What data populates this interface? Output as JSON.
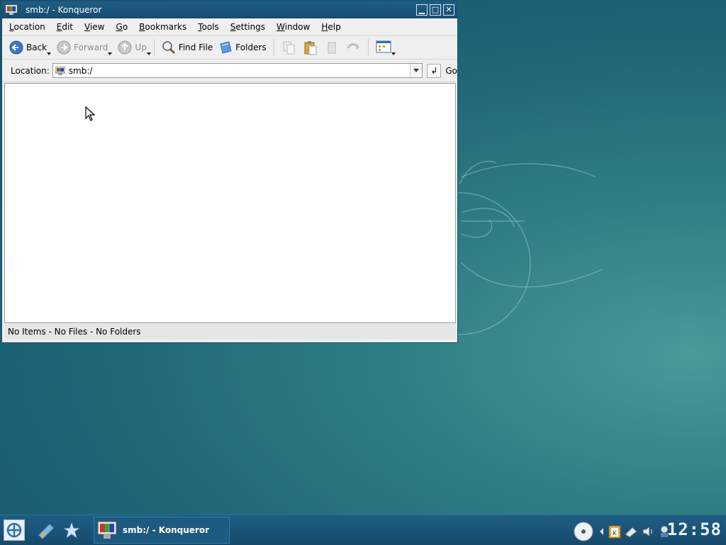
{
  "window": {
    "title": "smb:/ - Konqueror",
    "controls": {
      "minimize": "▁",
      "maximize": "□",
      "close": "✕"
    }
  },
  "menubar": {
    "items": [
      {
        "label": "Location",
        "underline": "L",
        "rest": "ocation"
      },
      {
        "label": "Edit",
        "underline": "E",
        "rest": "dit"
      },
      {
        "label": "View",
        "underline": "V",
        "rest": "iew"
      },
      {
        "label": "Go",
        "underline": "G",
        "rest": "o"
      },
      {
        "label": "Bookmarks",
        "underline": "B",
        "rest": "ookmarks"
      },
      {
        "label": "Tools",
        "underline": "T",
        "rest": "ools"
      },
      {
        "label": "Settings",
        "underline": "S",
        "rest": "ettings"
      },
      {
        "label": "Window",
        "underline": "W",
        "rest": "indow"
      },
      {
        "label": "Help",
        "underline": "H",
        "rest": "elp"
      }
    ]
  },
  "toolbar": {
    "back": "Back",
    "forward": "Forward",
    "up": "Up",
    "find_file": "Find File",
    "folders": "Folders"
  },
  "location_bar": {
    "label": "Location:",
    "value": "smb:/",
    "go": "Go"
  },
  "statusbar": {
    "text": "No Items - No Files - No Folders"
  },
  "taskbar": {
    "task_label": "smb:/ - Konqueror",
    "clock": "12:58"
  }
}
